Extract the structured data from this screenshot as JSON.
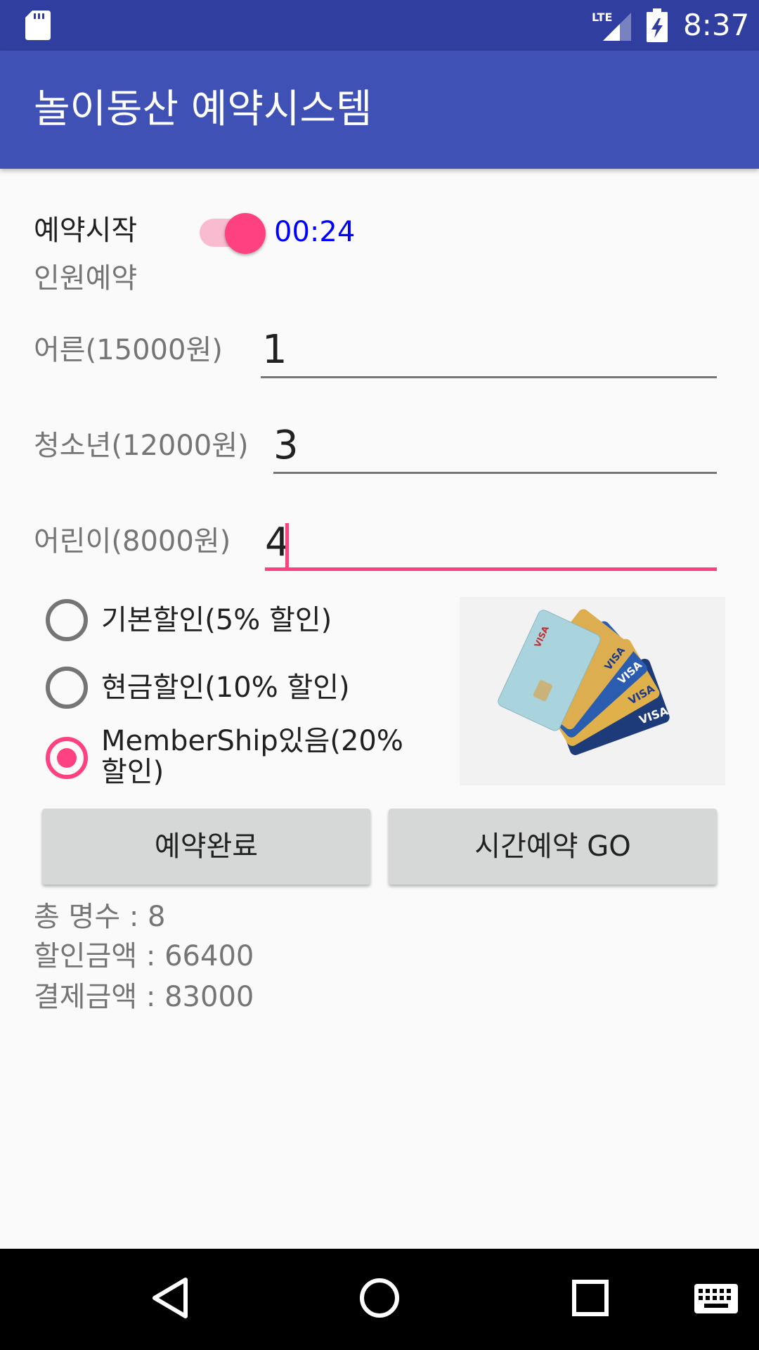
{
  "status_bar": {
    "time": "8:37",
    "network": "LTE",
    "icons": [
      "sd-card-icon",
      "lte-signal-icon",
      "battery-charging-icon"
    ]
  },
  "app_bar": {
    "title": "놀이동산 예약시스템"
  },
  "reservation": {
    "start_label": "예약시작",
    "switch_on": true,
    "timer": "00:24",
    "section_label": "인원예약",
    "fields": [
      {
        "label": "어른(15000원)",
        "value": "1"
      },
      {
        "label": "청소년(12000원)",
        "value": "3"
      },
      {
        "label": "어린이(8000원)",
        "value": "4"
      }
    ]
  },
  "discounts": {
    "options": [
      {
        "label": "기본할인(5% 할인)",
        "checked": false
      },
      {
        "label": "현금할인(10% 할인)",
        "checked": false
      },
      {
        "label": "MemberShip있음(20% 할인)",
        "checked": true
      }
    ],
    "image": "credit-cards-image"
  },
  "buttons": {
    "complete": "예약완료",
    "time_go": "시간예약 GO"
  },
  "summary": {
    "total_count": "총 명수 : 8",
    "discount_amount": "할인금액 : 66400",
    "payment_amount": "결제금액 : 83000"
  },
  "nav_bar": {
    "icons": [
      "back-icon",
      "home-icon",
      "recents-icon",
      "keyboard-icon"
    ]
  },
  "colors": {
    "status_bar": "#303f9f",
    "app_bar": "#3f51b5",
    "accent": "#ff4081",
    "timer": "#0000ff"
  }
}
